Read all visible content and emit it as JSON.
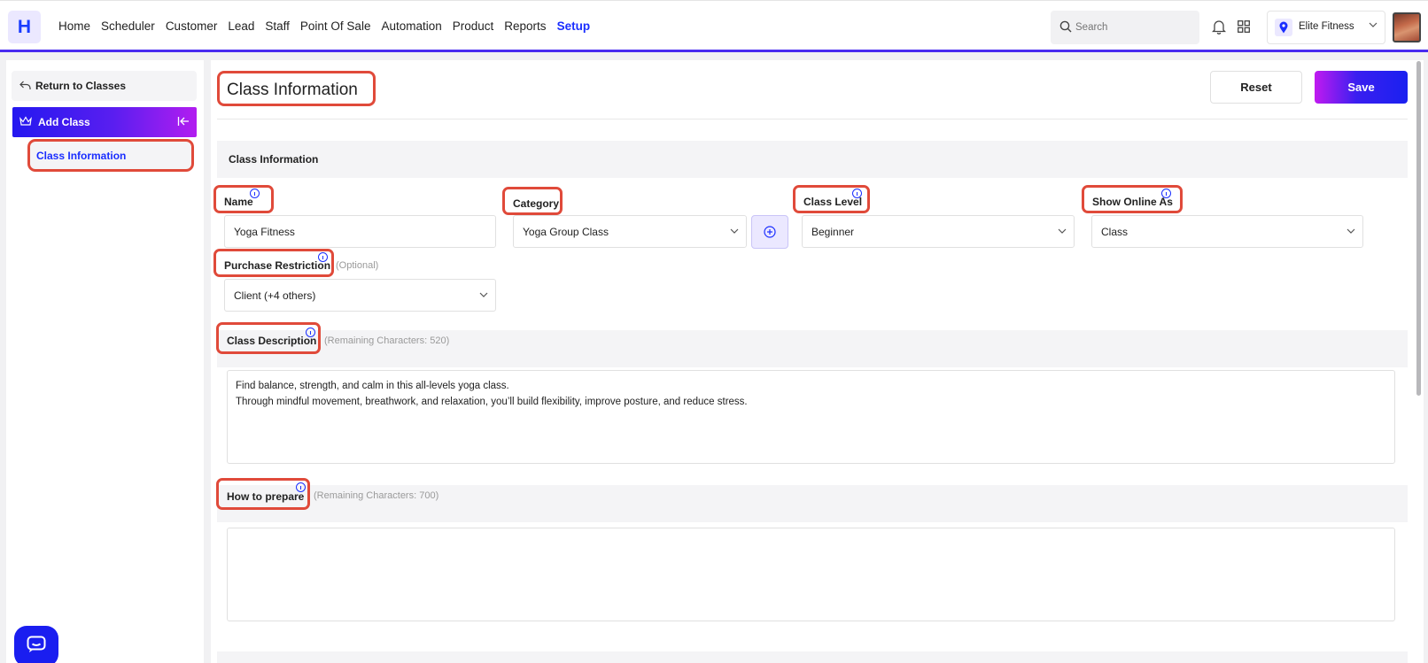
{
  "app": {
    "logo_letter": "H"
  },
  "nav": {
    "items": [
      "Home",
      "Scheduler",
      "Customer",
      "Lead",
      "Staff",
      "Point Of Sale",
      "Automation",
      "Product",
      "Reports",
      "Setup"
    ],
    "active": "Setup"
  },
  "search": {
    "placeholder": "Search"
  },
  "location": {
    "name": "Elite Fitness"
  },
  "sidebar": {
    "return_label": "Return to Classes",
    "add_class_label": "Add Class",
    "items": [
      {
        "label": "Class Information",
        "active": true
      }
    ]
  },
  "main": {
    "title": "Class Information",
    "reset_label": "Reset",
    "save_label": "Save",
    "section_title": "Class Information",
    "fields": {
      "name": {
        "label": "Name",
        "value": "Yoga  Fitness"
      },
      "category": {
        "label": "Category",
        "value": "Yoga Group Class"
      },
      "class_level": {
        "label": "Class Level",
        "value": "Beginner"
      },
      "show_online_as": {
        "label": "Show Online As",
        "value": "Class"
      },
      "purchase_restriction": {
        "label": "Purchase Restriction",
        "optional_note": "(Optional)",
        "value": "Client (+4 others)"
      }
    },
    "class_description": {
      "label": "Class Description",
      "remaining": "(Remaining Characters: 520)",
      "lines": [
        "Find balance, strength, and calm in this all-levels yoga class.",
        "Through mindful movement, breathwork, and relaxation, you’ll build flexibility, improve posture, and reduce stress."
      ]
    },
    "how_to_prepare": {
      "label": "How to prepare",
      "remaining": "(Remaining Characters: 700)",
      "value": ""
    }
  },
  "colors": {
    "accent": "#1a2eff",
    "highlight": "#e04a3a",
    "gradient_start": "#2418f0",
    "gradient_end": "#b21df0"
  },
  "icons": [
    "search-icon",
    "bell-icon",
    "apps-grid-icon",
    "location-pin-icon",
    "chevron-down-icon",
    "return-arrow-icon",
    "crown-icon",
    "collapse-sidebar-icon",
    "info-icon",
    "add-circle-icon",
    "chat-icon"
  ]
}
